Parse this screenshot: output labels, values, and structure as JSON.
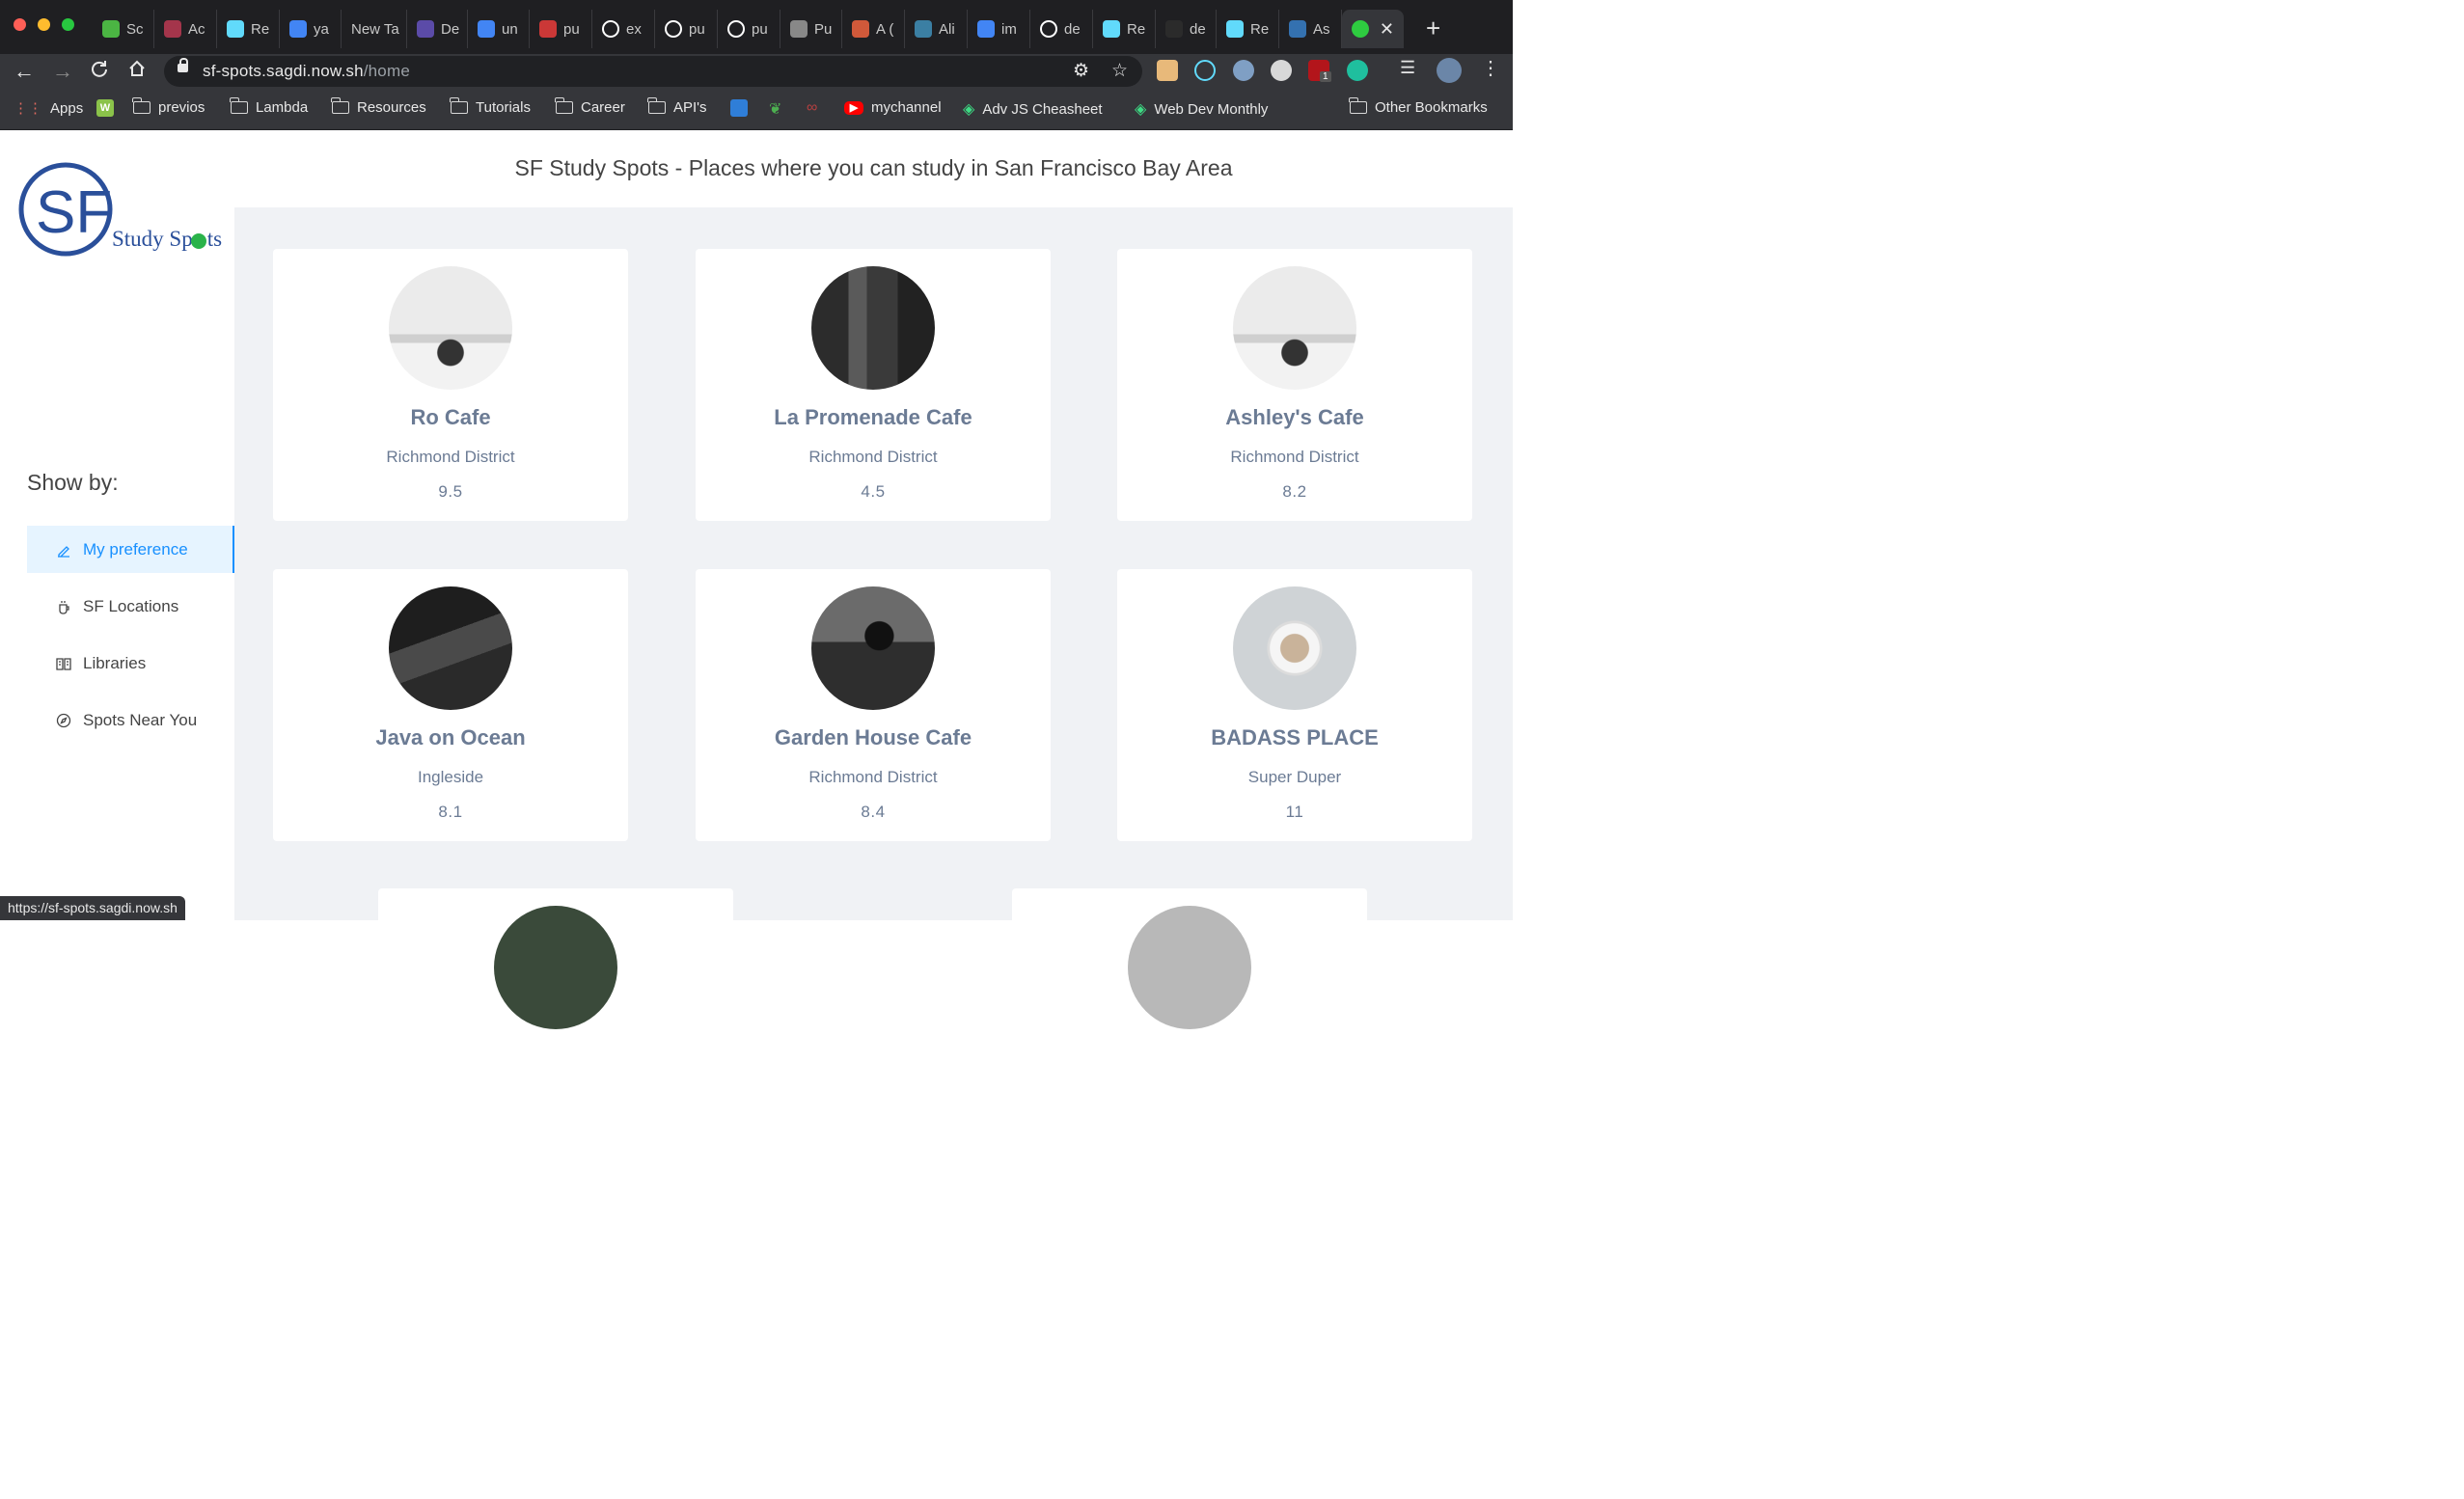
{
  "browser": {
    "tabs": [
      {
        "label": "Sc",
        "icon": "trello-icon",
        "color": "#4bb543"
      },
      {
        "label": "Ac",
        "icon": "udemy-icon",
        "color": "#a4354b"
      },
      {
        "label": "Re",
        "icon": "react-icon",
        "color": "#61dafb"
      },
      {
        "label": "ya",
        "icon": "google-icon",
        "color": "#4285f4"
      },
      {
        "label": "New Ta",
        "icon": "",
        "color": ""
      },
      {
        "label": "De",
        "icon": "bookmark-icon",
        "color": "#5b4ba8"
      },
      {
        "label": "un",
        "icon": "google-icon",
        "color": "#4285f4"
      },
      {
        "label": "pu",
        "icon": "npm-icon",
        "color": "#cb3837"
      },
      {
        "label": "ex",
        "icon": "github-icon",
        "color": "#ffffff"
      },
      {
        "label": "pu",
        "icon": "github-icon",
        "color": "#ffffff"
      },
      {
        "label": "pu",
        "icon": "github-icon",
        "color": "#ffffff"
      },
      {
        "label": "Pu",
        "icon": "globe-icon",
        "color": "#888888"
      },
      {
        "label": "A (",
        "icon": "pinwheel-icon",
        "color": "#d0593a"
      },
      {
        "label": "Ali",
        "icon": "image-icon",
        "color": "#3b7fa3"
      },
      {
        "label": "im",
        "icon": "google-icon",
        "color": "#4285f4"
      },
      {
        "label": "de",
        "icon": "github-icon",
        "color": "#ffffff"
      },
      {
        "label": "Re",
        "icon": "react-icon",
        "color": "#61dafb"
      },
      {
        "label": "de",
        "icon": "triangle-icon",
        "color": "#2b2b2b"
      },
      {
        "label": "Re",
        "icon": "react-icon",
        "color": "#61dafb"
      },
      {
        "label": "As",
        "icon": "doc-icon",
        "color": "#3471b0"
      }
    ],
    "active_tab_icon": "green-dot-icon",
    "url_host": "sf-spots.sagdi.now.sh",
    "url_path": "/home",
    "bookmarks": [
      {
        "label": "Apps",
        "type": "apps"
      },
      {
        "label": "",
        "type": "green-square"
      },
      {
        "label": "previos",
        "type": "folder"
      },
      {
        "label": "Lambda",
        "type": "folder"
      },
      {
        "label": "Resources",
        "type": "folder"
      },
      {
        "label": "Tutorials",
        "type": "folder"
      },
      {
        "label": "Career",
        "type": "folder"
      },
      {
        "label": "API's",
        "type": "folder"
      },
      {
        "label": "",
        "type": "trello"
      },
      {
        "label": "",
        "type": "feather"
      },
      {
        "label": "",
        "type": "swirl"
      },
      {
        "label": "mychannel",
        "type": "youtube"
      },
      {
        "label": "Adv JS Cheasheet",
        "type": "gem"
      },
      {
        "label": "Web Dev Monthly",
        "type": "gem"
      },
      {
        "label": "Other Bookmarks",
        "type": "folder"
      }
    ],
    "extension_badge": "1",
    "status_url": "https://sf-spots.sagdi.now.sh"
  },
  "page": {
    "title": "SF Study Spots - Places where you can study in San Francisco Bay Area",
    "logo": {
      "initials": "SF",
      "tagline_start": "Study Sp",
      "tagline_end": "ts"
    },
    "show_by": "Show by:",
    "menu": [
      {
        "label": "My preference",
        "icon": "edit-icon",
        "selected": true
      },
      {
        "label": "SF Locations",
        "icon": "coffee-cup-icon",
        "selected": false
      },
      {
        "label": "Libraries",
        "icon": "book-icon",
        "selected": false
      },
      {
        "label": "Spots Near You",
        "icon": "compass-icon",
        "selected": false
      }
    ],
    "cards": [
      {
        "name": "Ro Cafe",
        "district": "Richmond District",
        "rating": "9.5",
        "photo": "cafe-woman-photo"
      },
      {
        "name": "La Promenade Cafe",
        "district": "Richmond District",
        "rating": "4.5",
        "photo": "cafe-counter-photo"
      },
      {
        "name": "Ashley's Cafe",
        "district": "Richmond District",
        "rating": "8.2",
        "photo": "cafe-woman-photo"
      },
      {
        "name": "Java on Ocean",
        "district": "Ingleside",
        "rating": "8.1",
        "photo": "cafe-sign-photo"
      },
      {
        "name": "Garden House Cafe",
        "district": "Richmond District",
        "rating": "8.4",
        "photo": "barista-photo"
      },
      {
        "name": "BADASS PLACE",
        "district": "Super Duper",
        "rating": "11",
        "photo": "latte-photo"
      }
    ],
    "accent_color": "#1890ff",
    "card_text_color": "#6b7b94"
  }
}
